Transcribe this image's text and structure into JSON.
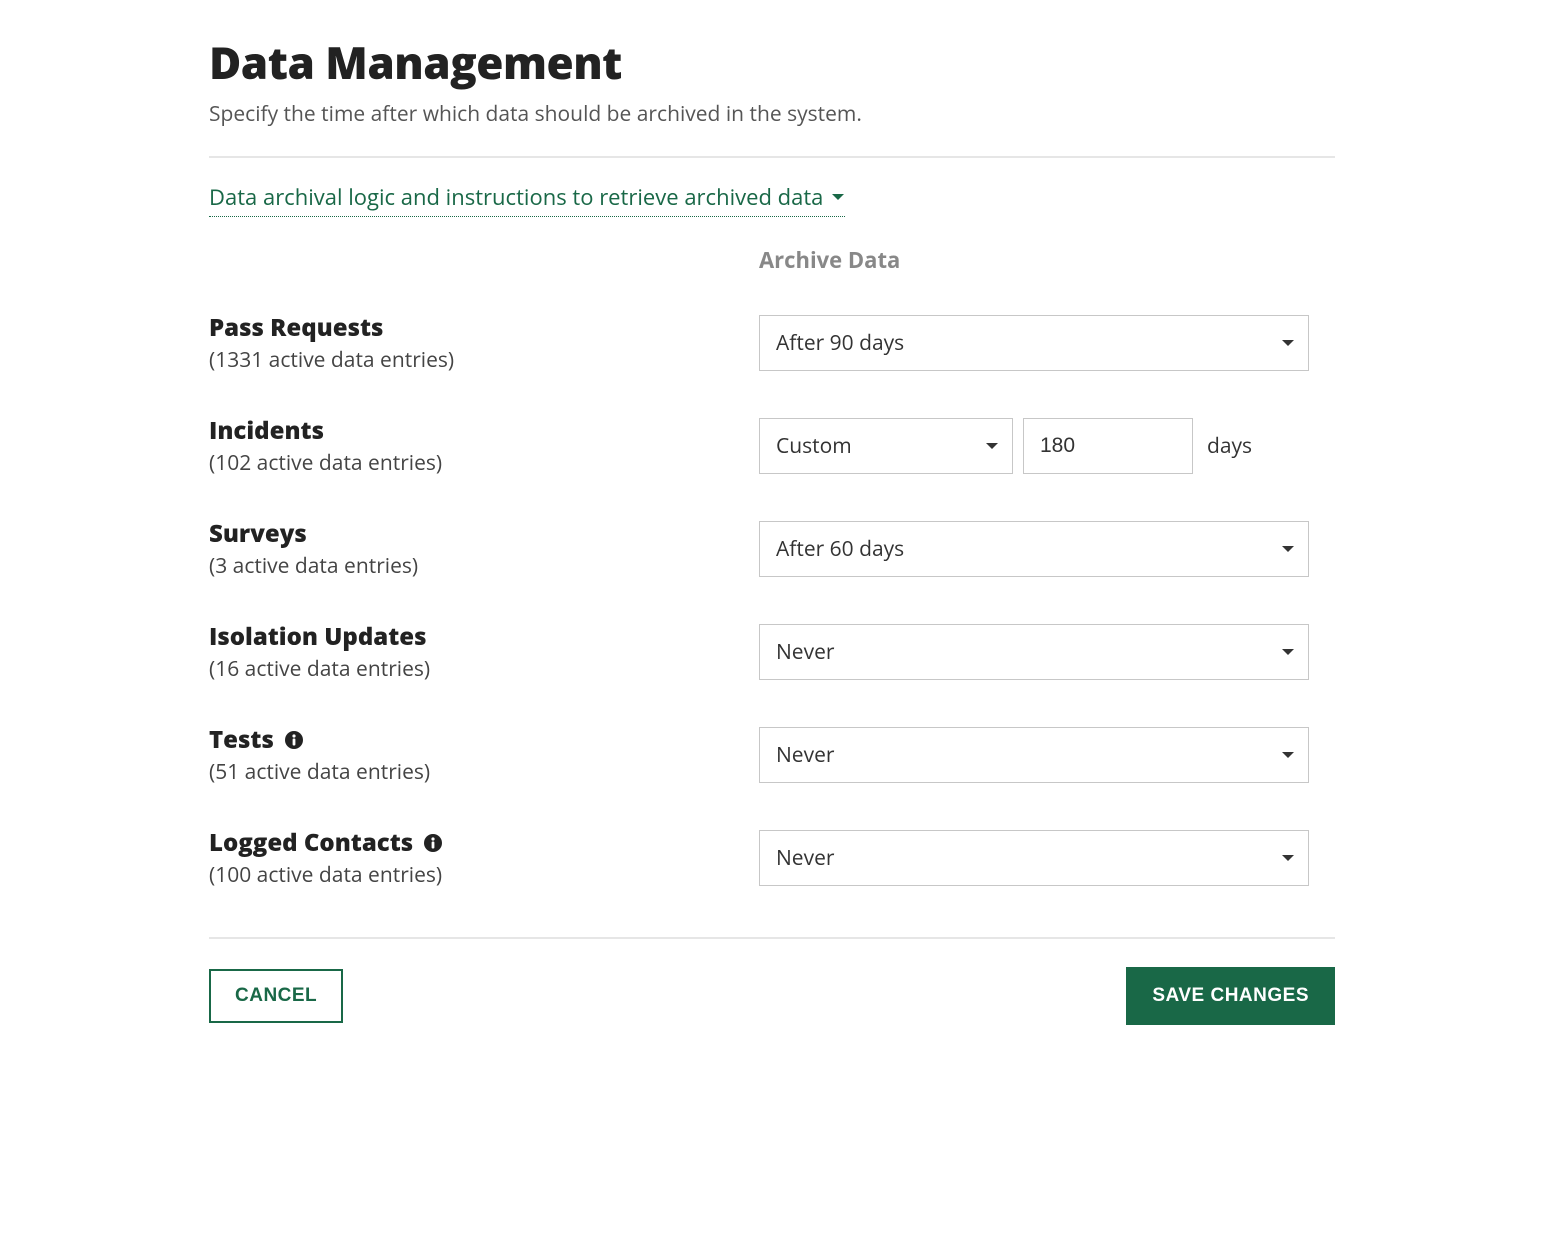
{
  "header": {
    "title": "Data Management",
    "subtitle": "Specify the time after which data should be archived in the system."
  },
  "archival_link": {
    "label": "Data archival logic and instructions to retrieve archived data"
  },
  "column_header": "Archive Data",
  "rows": {
    "pass_requests": {
      "title": "Pass Requests",
      "sub": "(1331 active data entries)",
      "select_value": "After 90 days"
    },
    "incidents": {
      "title": "Incidents",
      "sub": "(102 active data entries)",
      "select_value": "Custom",
      "custom_value": "180",
      "days_label": "days"
    },
    "surveys": {
      "title": "Surveys",
      "sub": "(3 active data entries)",
      "select_value": "After 60 days"
    },
    "isolation_updates": {
      "title": "Isolation Updates",
      "sub": "(16 active data entries)",
      "select_value": "Never"
    },
    "tests": {
      "title": "Tests",
      "sub": "(51 active data entries)",
      "select_value": "Never",
      "has_info": true
    },
    "logged_contacts": {
      "title": "Logged Contacts",
      "sub": "(100 active data entries)",
      "select_value": "Never",
      "has_info": true
    }
  },
  "footer": {
    "cancel": "CANCEL",
    "save": "SAVE CHANGES"
  }
}
